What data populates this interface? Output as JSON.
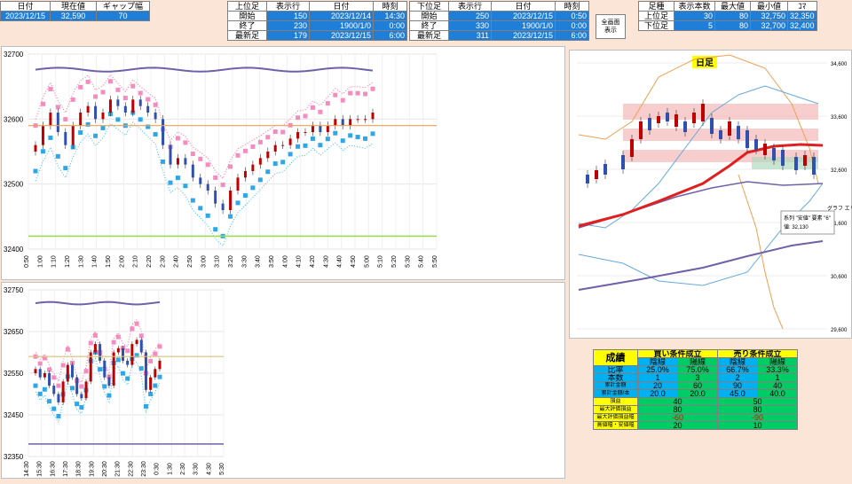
{
  "summary": {
    "headers": [
      "日付",
      "現在値",
      "ギャップ幅"
    ],
    "values": [
      "2023/12/15",
      "32,590",
      "70"
    ]
  },
  "upper": {
    "headers": [
      "上位足",
      "表示行",
      "日付",
      "時刻"
    ],
    "rows": [
      [
        "開始",
        "150",
        "2023/12/14",
        "14:30"
      ],
      [
        "終了",
        "230",
        "1900/1/0",
        "0:00"
      ],
      [
        "最新足",
        "179",
        "2023/12/15",
        "6:00"
      ]
    ]
  },
  "lower": {
    "headers": [
      "下位足",
      "表示行",
      "日付",
      "時刻"
    ],
    "rows": [
      [
        "開始",
        "250",
        "2023/12/15",
        "0:50"
      ],
      [
        "終了",
        "330",
        "1900/1/0",
        "0:00"
      ],
      [
        "最新足",
        "311",
        "2023/12/15",
        "6:00"
      ]
    ]
  },
  "fullscreen_button": [
    "全画面",
    "表示"
  ],
  "bars": {
    "headers": [
      "足種",
      "表示本数",
      "最大値",
      "最小値",
      "ｺﾏ"
    ],
    "rows": [
      [
        "上位足",
        "30",
        "80",
        "32,750",
        "32,350"
      ],
      [
        "下位足",
        "5",
        "80",
        "32,700",
        "32,400"
      ]
    ]
  },
  "stats": {
    "title": "成績",
    "buy_header": "買い条件成立",
    "sell_header": "売り条件成立",
    "sub": [
      "陰線",
      "陽線",
      "陰線",
      "陽線"
    ],
    "rows": [
      {
        "label": "比率",
        "vals": [
          "25.0%",
          "75.0%",
          "66.7%",
          "33.3%"
        ]
      },
      {
        "label": "本数",
        "vals": [
          "1",
          "3",
          "2",
          "1"
        ]
      },
      {
        "label": "累計金額",
        "vals": [
          "20",
          "60",
          "90",
          "40"
        ]
      },
      {
        "label": "累計金額/本",
        "vals": [
          "20.0",
          "20.0",
          "45.0",
          "40.0"
        ]
      }
    ],
    "merged": [
      {
        "label": "損益",
        "buy": "40",
        "sell": "50"
      },
      {
        "label": "最大評価損益",
        "buy": "80",
        "sell": "80"
      },
      {
        "label": "最大評価損益幅",
        "buy": "-60",
        "sell": "-90"
      },
      {
        "label": "高値幅・安値幅",
        "buy": "20",
        "sell": "10"
      }
    ]
  },
  "chart_data": [
    {
      "type": "line",
      "name": "top-left",
      "yticks": [
        "32700",
        "32600",
        "32500",
        "32400"
      ],
      "ylim": [
        32400,
        32700
      ],
      "xticks": [
        "0:50",
        "1:00",
        "1:10",
        "1:20",
        "1:30",
        "1:40",
        "1:50",
        "2:00",
        "2:10",
        "2:20",
        "2:30",
        "2:40",
        "2:50",
        "3:00",
        "3:10",
        "3:20",
        "3:30",
        "3:40",
        "3:50",
        "4:00",
        "4:10",
        "4:20",
        "4:30",
        "4:40",
        "4:50",
        "5:00",
        "5:10",
        "5:20",
        "5:30",
        "5:40",
        "5:50"
      ],
      "close": [
        32560,
        32590,
        32610,
        32580,
        32560,
        32590,
        32610,
        32620,
        32600,
        32610,
        32630,
        32620,
        32610,
        32630,
        32620,
        32610,
        32600,
        32560,
        32530,
        32540,
        32530,
        32510,
        32500,
        32490,
        32470,
        32460,
        32490,
        32510,
        32520,
        32530,
        32540,
        32550,
        32560,
        32560,
        32570,
        32580,
        32580,
        32590,
        32580,
        32590,
        32600,
        32590,
        32600,
        32600,
        32600,
        32610
      ]
    },
    {
      "type": "line",
      "name": "bottom-left",
      "yticks": [
        "32750",
        "32650",
        "32550",
        "32450",
        "32350"
      ],
      "ylim": [
        32350,
        32750
      ],
      "xticks": [
        "14:30",
        "15:30",
        "16:30",
        "17:30",
        "18:30",
        "19:30",
        "20:30",
        "21:30",
        "22:30",
        "23:30",
        "0:30",
        "1:30",
        "2:30",
        "3:30",
        "4:30",
        "5:30"
      ],
      "close": [
        32560,
        32540,
        32550,
        32520,
        32500,
        32480,
        32530,
        32570,
        32540,
        32500,
        32490,
        32530,
        32600,
        32620,
        32580,
        32540,
        32520,
        32600,
        32610,
        32580,
        32570,
        32620,
        32630,
        32600,
        32510,
        32540,
        32560,
        32580
      ]
    },
    {
      "type": "line",
      "name": "daily",
      "title": "日足",
      "yticks": [
        "34,600",
        "33,600",
        "32,600",
        "31,600",
        "30,600",
        "29,600"
      ],
      "ylim": [
        29600,
        34600
      ],
      "tooltip_title": "グラフ エリア",
      "tooltip": [
        "系列 \"安値\" 要素 \"6\"",
        "値: 32,130"
      ]
    }
  ]
}
